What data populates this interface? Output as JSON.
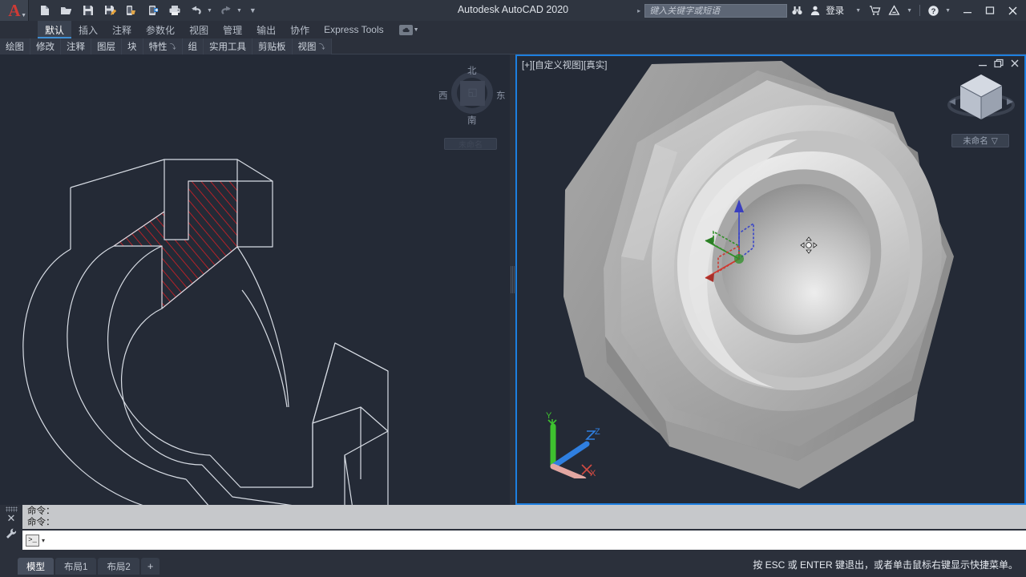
{
  "window": {
    "title": "Autodesk AutoCAD 2020",
    "controls": {
      "minimize": "–",
      "maximize": "☐",
      "close": "✕"
    }
  },
  "quick_access": {
    "items": [
      {
        "name": "new-file",
        "label": "新建"
      },
      {
        "name": "open-file",
        "label": "打开"
      },
      {
        "name": "save-file",
        "label": "保存"
      },
      {
        "name": "save-as",
        "label": "另存为"
      },
      {
        "name": "save-to-web",
        "label": "保存到 Web 和 Mobile"
      },
      {
        "name": "open-from-web",
        "label": "从 Web 和 Mobile 打开"
      },
      {
        "name": "plot",
        "label": "打印"
      },
      {
        "name": "undo",
        "label": "放弃"
      },
      {
        "name": "redo",
        "label": "重做"
      },
      {
        "name": "customize",
        "label": "自定义快速访问工具栏"
      }
    ]
  },
  "search": {
    "placeholder": "键入关键字或短语",
    "expand_arrow": "▸"
  },
  "account": {
    "signin_label": "登录",
    "dropdown_caret": "▾"
  },
  "ribbon": {
    "tabs": [
      {
        "label": "默认",
        "active": true
      },
      {
        "label": "插入",
        "active": false
      },
      {
        "label": "注释",
        "active": false
      },
      {
        "label": "参数化",
        "active": false
      },
      {
        "label": "视图",
        "active": false
      },
      {
        "label": "管理",
        "active": false
      },
      {
        "label": "输出",
        "active": false
      },
      {
        "label": "协作",
        "active": false
      },
      {
        "label": "Express Tools",
        "active": false
      }
    ],
    "panels": [
      {
        "label": "绘图",
        "expander": false
      },
      {
        "label": "修改",
        "expander": false
      },
      {
        "label": "注释",
        "expander": false
      },
      {
        "label": "图层",
        "expander": false
      },
      {
        "label": "块",
        "expander": false
      },
      {
        "label": "特性",
        "expander": true
      },
      {
        "label": "组",
        "expander": false
      },
      {
        "label": "实用工具",
        "expander": false
      },
      {
        "label": "剪贴板",
        "expander": false
      },
      {
        "label": "视图",
        "expander": true
      }
    ],
    "expander_glyph": "⤵"
  },
  "viewport_left": {
    "compass": {
      "north": "北",
      "south": "南",
      "west": "西",
      "east": "东",
      "center_glyph": "◱"
    },
    "named_view": "未命名",
    "drawing_title": "C 形支架线框图（带红色剖面线）"
  },
  "viewport_right": {
    "label": "[+][自定义视图][真实]",
    "controls": {
      "minimize": "–",
      "restore": "❐",
      "close": "✕"
    },
    "named_view": "未命名",
    "named_view_caret": "▽",
    "ucs_axes": {
      "x": "X",
      "y": "Y",
      "z": "Z"
    },
    "model_title": "六角凸缘实体（沉孔）"
  },
  "command_line": {
    "history": [
      "命令：",
      "命令："
    ],
    "input_value": "",
    "prompt_glyph": ">_",
    "prompt_caret": "▾",
    "close_glyph": "✕"
  },
  "status_bar": {
    "layout_tabs": [
      {
        "label": "模型",
        "active": true
      },
      {
        "label": "布局1",
        "active": false
      },
      {
        "label": "布局2",
        "active": false
      }
    ],
    "add_layout": "+",
    "message": "按 ESC 或 ENTER 键退出，或者单击鼠标右键显示快捷菜单。"
  },
  "colors": {
    "canvas_bg": "#242a36",
    "chrome_bg": "#2b303b",
    "active_viewport_border": "#1d7fe0",
    "accent_blue": "#3f8fd4",
    "hatch_red": "#c42026",
    "wireframe": "#d8dde5",
    "axis_x": "#d13b33",
    "axis_y": "#3aa02f",
    "axis_z": "#3a46c8",
    "logo_red": "#cf3b36"
  }
}
